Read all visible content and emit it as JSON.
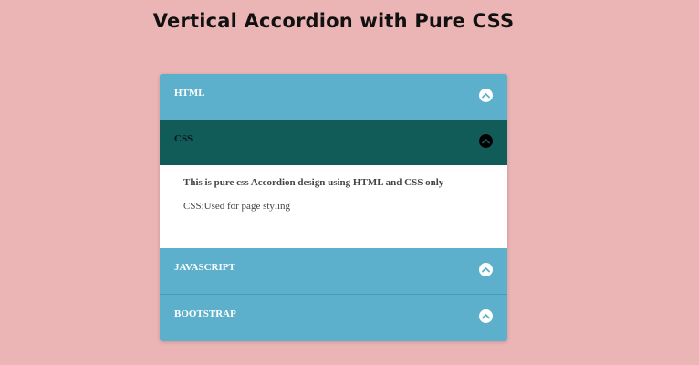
{
  "page": {
    "title": "Vertical Accordion with Pure CSS"
  },
  "accordion": {
    "items": [
      {
        "label": "HTML",
        "expanded": false,
        "icon": "chevron-up-icon"
      },
      {
        "label": "CSS",
        "expanded": true,
        "icon": "chevron-up-icon"
      },
      {
        "label": "JAVASCRIPT",
        "expanded": false,
        "icon": "chevron-up-icon"
      },
      {
        "label": "BOOTSTRAP",
        "expanded": false,
        "icon": "chevron-up-icon"
      }
    ],
    "panel": {
      "heading": "This is pure css Accordion design using HTML and CSS only",
      "text": "CSS:Used for page styling"
    }
  },
  "colors": {
    "background": "#ecb5b5",
    "header": "#5db0cb",
    "active_header": "#115b59",
    "panel": "#ffffff"
  }
}
